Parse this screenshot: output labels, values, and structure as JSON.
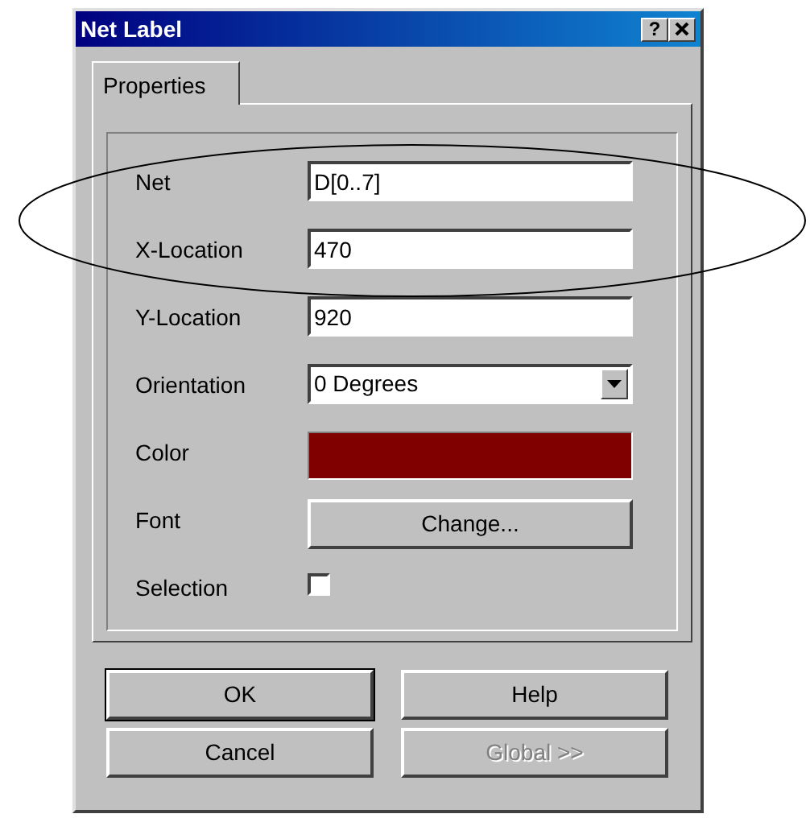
{
  "window": {
    "title": "Net Label",
    "help": "?"
  },
  "tabs": [
    {
      "label": "Properties",
      "selected": true
    }
  ],
  "fields": [
    {
      "kind": "text",
      "label": "Net",
      "value": "D[0..7]"
    },
    {
      "kind": "text",
      "label": "X-Location",
      "value": "470"
    },
    {
      "kind": "text",
      "label": "Y-Location",
      "value": "920"
    },
    {
      "kind": "dropdown",
      "label": "Orientation",
      "value": "0 Degrees"
    },
    {
      "kind": "color",
      "label": "Color",
      "color": "#800000"
    },
    {
      "kind": "button",
      "label": "Font",
      "value": "Change..."
    },
    {
      "kind": "checkbox",
      "label": "Selection",
      "checked": false
    }
  ],
  "buttons": [
    {
      "label": "OK",
      "default": true,
      "disabled": false
    },
    {
      "label": "Help",
      "default": false,
      "disabled": false
    },
    {
      "label": "Cancel",
      "default": false,
      "disabled": false
    },
    {
      "label": "Global >>",
      "default": false,
      "disabled": true
    }
  ],
  "annotation": {
    "kind": "ellipse"
  }
}
